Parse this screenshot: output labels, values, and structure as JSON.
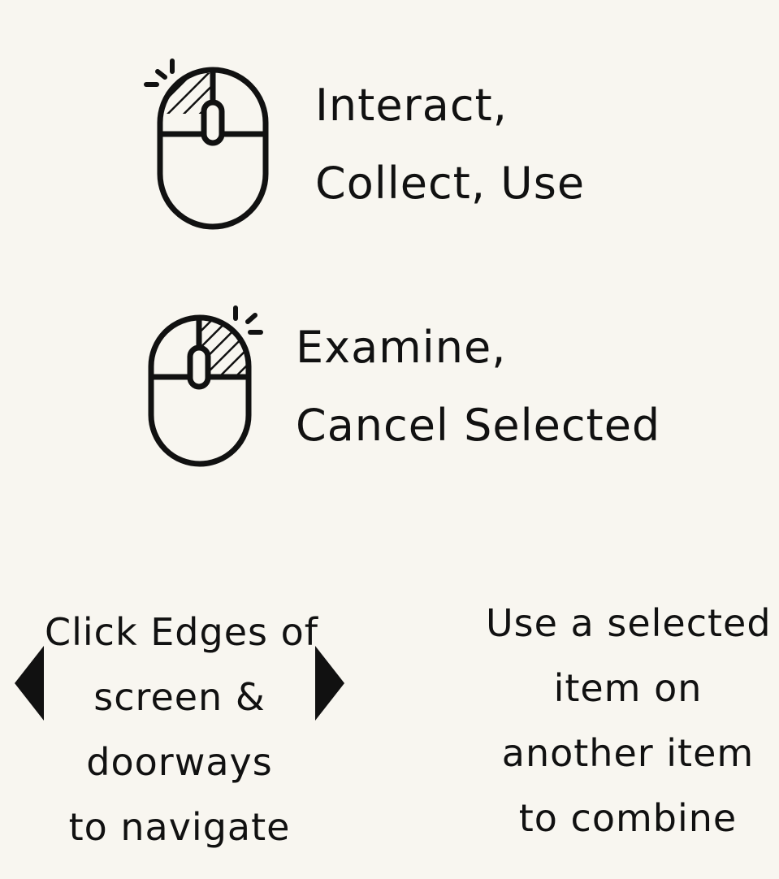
{
  "colors": {
    "background": "#f8f6f0",
    "ink": "#111111"
  },
  "instructions": {
    "left_click": {
      "icon": "mouse-left-click-icon",
      "line1": "Interact,",
      "line2": "Collect, Use"
    },
    "right_click": {
      "icon": "mouse-right-click-icon",
      "line1": "Examine,",
      "line2": "Cancel Selected"
    },
    "navigate": {
      "icons": [
        "arrow-left-icon",
        "arrow-right-icon"
      ],
      "lines": [
        "Click Edges of",
        "screen &",
        "doorways",
        "to navigate"
      ]
    },
    "combine": {
      "lines": [
        "Use a selected",
        "item on",
        "another item",
        "to combine"
      ]
    }
  }
}
